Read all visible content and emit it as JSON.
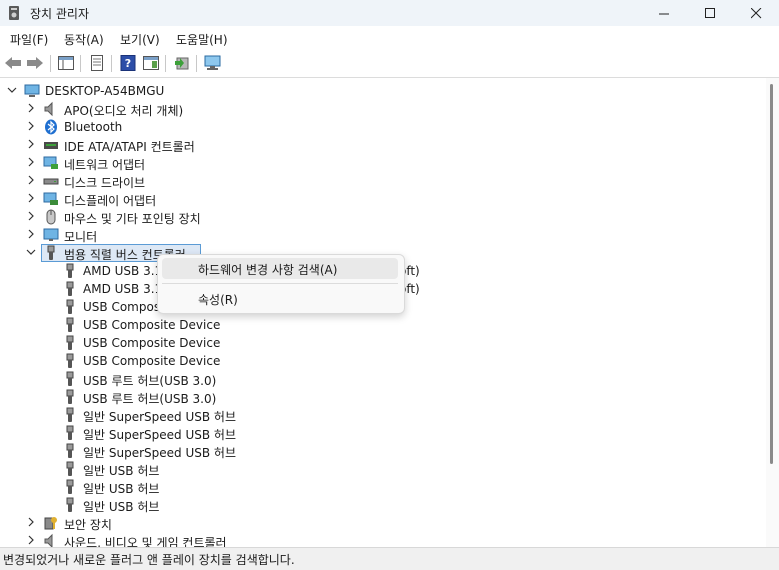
{
  "window": {
    "title": "장치 관리자"
  },
  "menu": [
    "파일(F)",
    "동작(A)",
    "보기(V)",
    "도움말(H)"
  ],
  "tree": {
    "root": "DESKTOP-A54BMGU",
    "categories": [
      {
        "label": "APO(오디오 처리 개체)",
        "icon": "audio-processing-icon"
      },
      {
        "label": "Bluetooth",
        "icon": "bluetooth-icon"
      },
      {
        "label": "IDE ATA/ATAPI 컨트롤러",
        "icon": "ide-controller-icon"
      },
      {
        "label": "네트워크 어댑터",
        "icon": "network-adapter-icon"
      },
      {
        "label": "디스크 드라이브",
        "icon": "disk-drive-icon"
      },
      {
        "label": "디스플레이 어댑터",
        "icon": "display-adapter-icon"
      },
      {
        "label": "마우스 및 기타 포인팅 장치",
        "icon": "mouse-icon"
      },
      {
        "label": "모니터",
        "icon": "monitor-icon"
      }
    ],
    "expanded": {
      "label": "범용 직렬 버스 컨트롤러",
      "children": [
        "AMD USB 3.1",
        "AMD USB 3.1",
        "USB Composite Device",
        "USB Composite Device",
        "USB Composite Device",
        "USB Composite Device",
        "USB 루트 허브(USB 3.0)",
        "USB 루트 허브(USB 3.0)",
        "일반 SuperSpeed USB 허브",
        "일반 SuperSpeed USB 허브",
        "일반 SuperSpeed USB 허브",
        "일반 USB 허브",
        "일반 USB 허브",
        "일반 USB 허브"
      ]
    },
    "after": [
      {
        "label": "보안 장치",
        "icon": "security-device-icon"
      },
      {
        "label": "사운드, 비디오 및 게임 컨트롤러",
        "icon": "sound-icon"
      }
    ],
    "partial_suffix_1": "oft)",
    "partial_suffix_2": "oft)"
  },
  "context_menu": {
    "scan": "하드웨어 변경 사항 검색(A)",
    "properties": "속성(R)"
  },
  "status": "변경되었거나 새로운 플러그 앤 플레이 장치를 검색합니다."
}
